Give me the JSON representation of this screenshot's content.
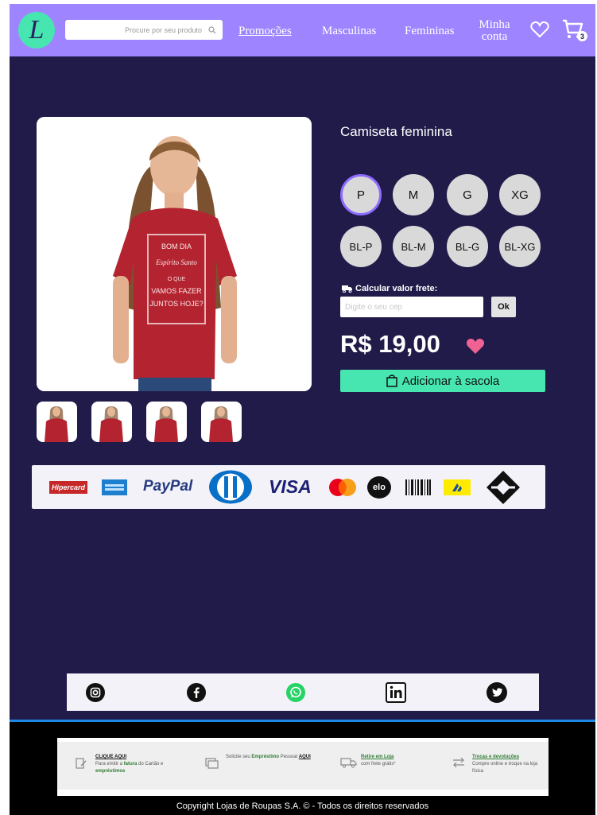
{
  "header": {
    "logo_letter": "L",
    "search_placeholder": "Procure por seu produto",
    "nav": {
      "promocoes": "Promoções",
      "masculinas": "Masculinas",
      "femininas": "Femininas",
      "minha_conta": "Minha conta"
    },
    "cart_count": "3",
    "accent_color": "#9e85ff"
  },
  "product": {
    "title": "Camiseta feminina",
    "shirt_text": [
      "BOM DIA",
      "Espírito Santo",
      "O QUE",
      "VAMOS FAZER",
      "JUNTOS HOJE?"
    ],
    "sizes": [
      "P",
      "M",
      "G",
      "XG",
      "BL-P",
      "BL-M",
      "BL-G",
      "BL-XG"
    ],
    "selected_size": "P",
    "shipping_label": "Calcular valor frete:",
    "cep_placeholder": "Digite o seu cep",
    "ok_label": "Ok",
    "price": "R$ 19,00",
    "add_to_bag": "Adicionar à sacola",
    "button_color": "#47e6b0",
    "favorite_color": "#f06292"
  },
  "payments": {
    "hipercard": "Hipercard",
    "paypal": "PayPal",
    "visa": "VISA",
    "elo": "elo"
  },
  "social": [
    "instagram-icon",
    "facebook-icon",
    "whatsapp-icon",
    "linkedin-icon",
    "twitter-icon"
  ],
  "footer": {
    "item1_link": "CLIQUE AQUI",
    "item1_text_a": "Para emitir a ",
    "item1_hl1": "fatura",
    "item1_text_b": " do Cartão e ",
    "item1_hl2": "empréstimos",
    "item2_text_a": "Solicite seu ",
    "item2_hl": "Empréstimo",
    "item2_text_b": " Pessoal ",
    "item2_link": "AQUI",
    "item3_link": "Retire em Loja",
    "item3_text": "com frete grátis*",
    "item4_link": "Trocas e devoluções",
    "item4_text": "Compre online e troque na loja física",
    "copyright": "Copyright Lojas de Roupas S.A. © - Todos os direitos reservados"
  }
}
